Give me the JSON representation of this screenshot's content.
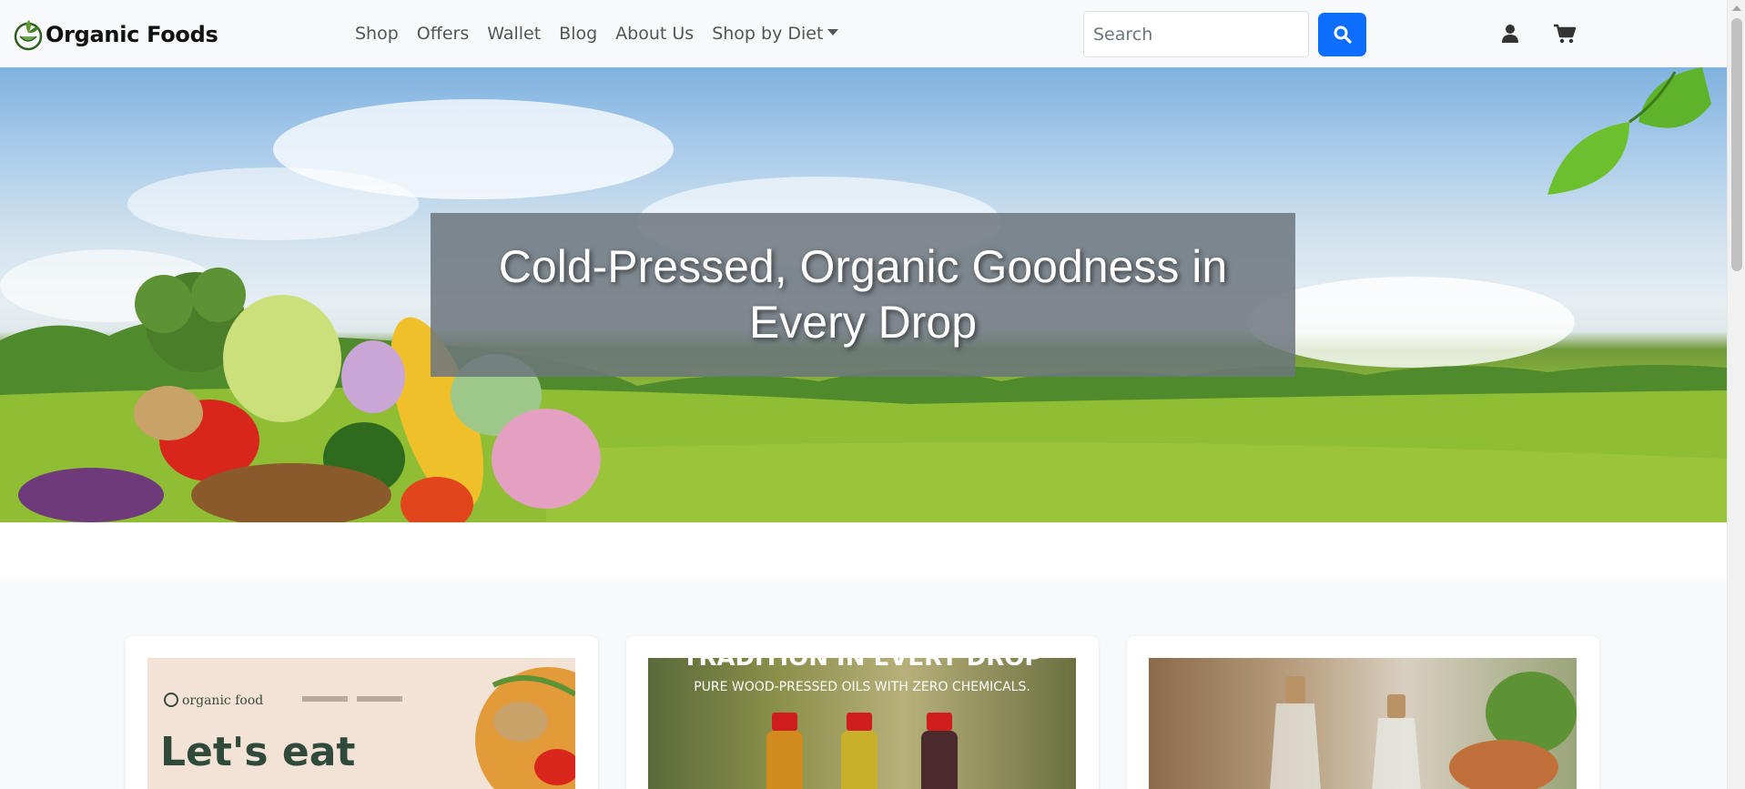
{
  "brand": {
    "name": "Organic Foods",
    "logo_icon": "leaf-bowl-logo"
  },
  "nav": {
    "items": [
      {
        "label": "Shop"
      },
      {
        "label": "Offers"
      },
      {
        "label": "Wallet"
      },
      {
        "label": "Blog"
      },
      {
        "label": "About Us"
      },
      {
        "label": "Shop by Diet"
      }
    ]
  },
  "search": {
    "placeholder": "Search",
    "value": "",
    "button_icon": "search-icon"
  },
  "header_icons": {
    "user": "user-icon",
    "cart": "cart-icon"
  },
  "hero": {
    "title": "Cold-Pressed, Organic Goodness in Every Drop"
  },
  "cards": [
    {
      "image": "organic-food-banner",
      "text": "Let's eat",
      "brand_text": "organic food"
    },
    {
      "image": "wood-pressed-oils",
      "headline": "TRADITION IN EVERY DROP",
      "subline": "PURE WOOD-PRESSED OILS WITH ZERO CHEMICALS."
    },
    {
      "image": "oil-bottles-photo"
    }
  ],
  "colors": {
    "primary": "#0d6efd",
    "navbar_bg": "#f8f9fa",
    "overlay": "#6c757d"
  }
}
